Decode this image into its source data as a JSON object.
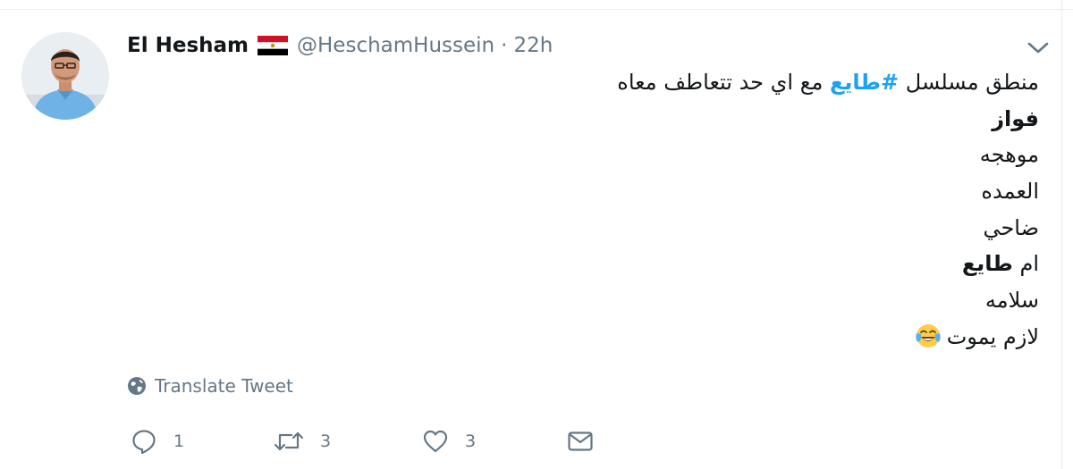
{
  "tweet": {
    "author": {
      "display_name": "El Hesham",
      "handle": "@HeschamHussein",
      "flag_icon": "egypt-flag-icon"
    },
    "separator": "·",
    "time": "22h",
    "text_lines": [
      {
        "before": "منطق مسلسل ",
        "hashtag": "#طايع",
        "after": " مع اي حد تتعاطف معاه"
      },
      {
        "text": "فواز",
        "bold": true
      },
      {
        "text": "موهجه"
      },
      {
        "text": "العمده"
      },
      {
        "text": "ضاحي"
      },
      {
        "prefix": "ام ",
        "bold_part": "طايع"
      },
      {
        "text": "سلامه"
      },
      {
        "text": "لازم يموت",
        "emoji": "face-with-tears-of-joy-icon"
      }
    ],
    "translate_label": "Translate Tweet",
    "actions": {
      "reply": {
        "icon": "reply-icon",
        "count": "1"
      },
      "retweet": {
        "icon": "retweet-icon",
        "count": "3"
      },
      "like": {
        "icon": "heart-icon",
        "count": "3"
      },
      "message": {
        "icon": "envelope-icon"
      }
    }
  },
  "colors": {
    "text": "#14171a",
    "secondary": "#657786",
    "link": "#1da1f2",
    "border": "#e6ecf0"
  }
}
